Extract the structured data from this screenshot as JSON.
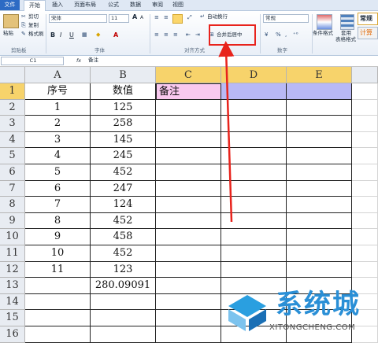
{
  "tabs": [
    {
      "label": "文件"
    },
    {
      "label": "开始"
    },
    {
      "label": "插入"
    },
    {
      "label": "页面布局"
    },
    {
      "label": "公式"
    },
    {
      "label": "数据"
    },
    {
      "label": "审阅"
    },
    {
      "label": "视图"
    }
  ],
  "clipboard": {
    "paste": "粘贴",
    "cut": "剪切",
    "copy": "复制",
    "format_painter": "格式刷",
    "group": "剪贴板"
  },
  "font": {
    "name": "宋体",
    "size": "11",
    "grow": "A",
    "shrink": "A",
    "bold": "B",
    "italic": "I",
    "underline": "U",
    "font_color": "A",
    "group": "字体"
  },
  "alignment": {
    "wrap": "自动换行",
    "merge": "合并后居中",
    "group": "对齐方式"
  },
  "number": {
    "format": "常规",
    "group": "数字"
  },
  "styles": {
    "conditional": "条件格式",
    "table_line1": "套用",
    "table_line2": "表格格式",
    "normal": "常规",
    "calc": "计算"
  },
  "formula_bar": {
    "name_box": "C1",
    "fx": "fx",
    "content": "备注"
  },
  "columns": [
    "A",
    "B",
    "C",
    "D",
    "E"
  ],
  "rows": [
    "1",
    "2",
    "3",
    "4",
    "5",
    "6",
    "7",
    "8",
    "9",
    "10",
    "11",
    "12",
    "13",
    "14",
    "15",
    "16"
  ],
  "table": {
    "headers": [
      "序号",
      "数值",
      "备注"
    ],
    "rows": [
      [
        "1",
        "125"
      ],
      [
        "2",
        "258"
      ],
      [
        "3",
        "145"
      ],
      [
        "4",
        "245"
      ],
      [
        "5",
        "452"
      ],
      [
        "6",
        "247"
      ],
      [
        "7",
        "124"
      ],
      [
        "8",
        "452"
      ],
      [
        "9",
        "458"
      ],
      [
        "10",
        "452"
      ],
      [
        "11",
        "123"
      ]
    ],
    "average": "280.09091"
  },
  "watermark": {
    "title": "系统城",
    "url": "XITONGCHENG.COM"
  },
  "colors": {
    "selected_merge": "#f9c9ef",
    "selected_range": "#b9b9f5",
    "highlight": "#e8231c",
    "file_tab": "#2d6bc4"
  }
}
